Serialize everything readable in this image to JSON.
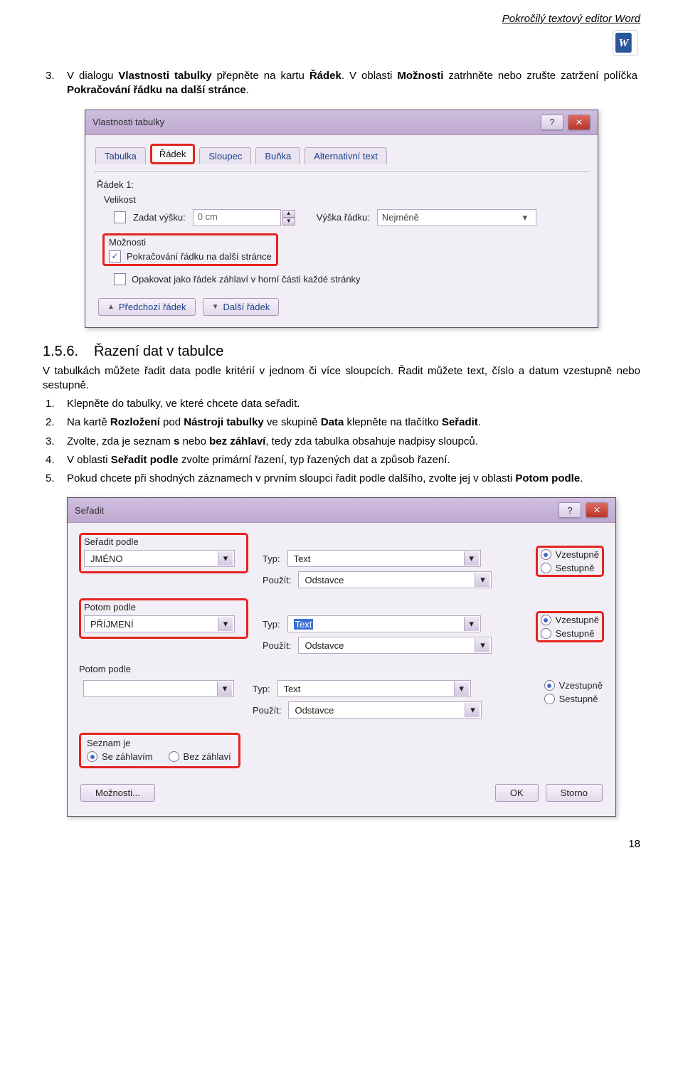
{
  "header": {
    "title": "Pokročilý textový editor Word"
  },
  "intro": {
    "num": "3.",
    "text_a": "V dialogu ",
    "bold_a": "Vlastnosti tabulky",
    "text_b": " přepněte na kartu ",
    "bold_b": "Řádek",
    "text_c": ". V oblasti ",
    "bold_c": "Možnosti",
    "text_d": " zatrhněte nebo zrušte zatržení políčka ",
    "bold_d": "Pokračování řádku na další stránce",
    "text_e": "."
  },
  "dlg1": {
    "title": "Vlastnosti tabulky",
    "tabs": {
      "t1": "Tabulka",
      "t2": "Řádek",
      "t3": "Sloupec",
      "t4": "Buňka",
      "t5": "Alternativní text"
    },
    "row_label": "Řádek 1:",
    "size_label": "Velikost",
    "zadat_vysku": "Zadat výšku:",
    "zero": "0 cm",
    "vyska_radku": "Výška řádku:",
    "nejmene": "Nejméně",
    "moznosti": "Možnosti",
    "pokracovani": "Pokračování řádku na další stránce",
    "opakovat": "Opakovat jako řádek záhlaví v horní části každé stránky",
    "prev": "Předchozí řádek",
    "next": "Další řádek"
  },
  "section": {
    "num": "1.5.6.",
    "title": "Řazení dat v tabulce"
  },
  "para2": "V tabulkách můžete řadit data podle kritérií v jednom či více sloupcích. Řadit můžete text, číslo a datum vzestupně nebo sestupně.",
  "steps": {
    "s1n": "1.",
    "s1": "Klepněte do tabulky, ve které chcete data seřadit.",
    "s2n": "2.",
    "s2a": "Na kartě ",
    "s2b": "Rozložení",
    "s2c": " pod ",
    "s2d": "Nástroji tabulky",
    "s2e": " ve skupině ",
    "s2f": "Data",
    "s2g": " klepněte na tlačítko ",
    "s2h": "Seřadit",
    "s2i": ".",
    "s3n": "3.",
    "s3a": "Zvolte, zda je seznam ",
    "s3b": "s",
    "s3c": " nebo ",
    "s3d": "bez záhlaví",
    "s3e": ", tedy zda tabulka obsahuje nadpisy sloupců.",
    "s4n": "4.",
    "s4a": "V oblasti ",
    "s4b": "Seřadit podle",
    "s4c": " zvolte primární řazení, typ řazených dat a způsob řazení.",
    "s5n": "5.",
    "s5a": "Pokud chcete při shodných záznamech v prvním sloupci řadit podle dalšího, zvolte jej v oblasti ",
    "s5b": "Potom podle",
    "s5c": "."
  },
  "dlg2": {
    "title": "Seřadit",
    "group1": "Seřadit podle",
    "group2": "Potom podle",
    "group3": "Potom podle",
    "field1": "JMÉNO",
    "field2": "PŘÍJMENÍ",
    "field3": "",
    "typ": "Typ:",
    "typ_val": "Text",
    "pouzit": "Použít:",
    "pouzit_val": "Odstavce",
    "vzestupne": "Vzestupně",
    "sestupne": "Sestupně",
    "seznam_je": "Seznam je",
    "se_zahlavim": "Se záhlavím",
    "bez_zahlavi": "Bez záhlaví",
    "moznosti": "Možnosti...",
    "ok": "OK",
    "storno": "Storno"
  },
  "page_number": "18"
}
